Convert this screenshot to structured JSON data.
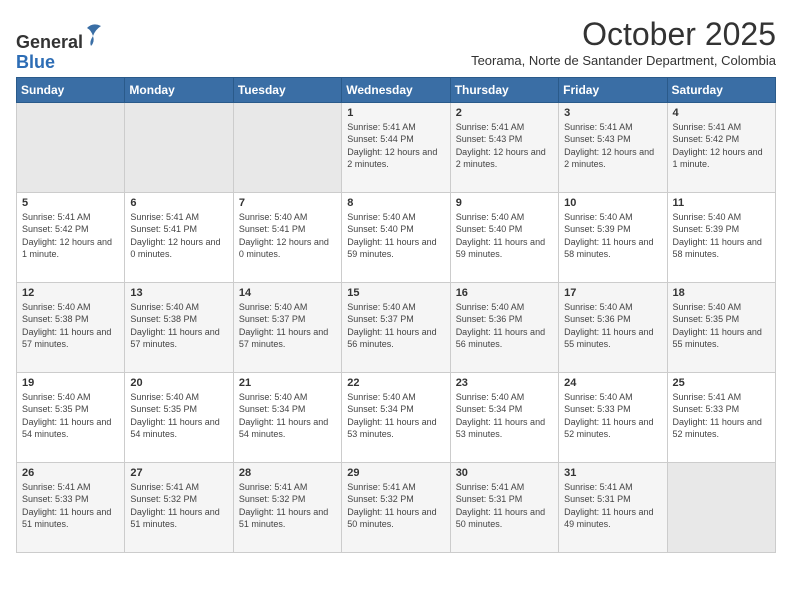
{
  "header": {
    "logo_line1": "General",
    "logo_line2": "Blue",
    "month": "October 2025",
    "subtitle": "Teorama, Norte de Santander Department, Colombia"
  },
  "days_of_week": [
    "Sunday",
    "Monday",
    "Tuesday",
    "Wednesday",
    "Thursday",
    "Friday",
    "Saturday"
  ],
  "weeks": [
    [
      {
        "day": "",
        "info": ""
      },
      {
        "day": "",
        "info": ""
      },
      {
        "day": "",
        "info": ""
      },
      {
        "day": "1",
        "info": "Sunrise: 5:41 AM\nSunset: 5:44 PM\nDaylight: 12 hours and 2 minutes."
      },
      {
        "day": "2",
        "info": "Sunrise: 5:41 AM\nSunset: 5:43 PM\nDaylight: 12 hours and 2 minutes."
      },
      {
        "day": "3",
        "info": "Sunrise: 5:41 AM\nSunset: 5:43 PM\nDaylight: 12 hours and 2 minutes."
      },
      {
        "day": "4",
        "info": "Sunrise: 5:41 AM\nSunset: 5:42 PM\nDaylight: 12 hours and 1 minute."
      }
    ],
    [
      {
        "day": "5",
        "info": "Sunrise: 5:41 AM\nSunset: 5:42 PM\nDaylight: 12 hours and 1 minute."
      },
      {
        "day": "6",
        "info": "Sunrise: 5:41 AM\nSunset: 5:41 PM\nDaylight: 12 hours and 0 minutes."
      },
      {
        "day": "7",
        "info": "Sunrise: 5:40 AM\nSunset: 5:41 PM\nDaylight: 12 hours and 0 minutes."
      },
      {
        "day": "8",
        "info": "Sunrise: 5:40 AM\nSunset: 5:40 PM\nDaylight: 11 hours and 59 minutes."
      },
      {
        "day": "9",
        "info": "Sunrise: 5:40 AM\nSunset: 5:40 PM\nDaylight: 11 hours and 59 minutes."
      },
      {
        "day": "10",
        "info": "Sunrise: 5:40 AM\nSunset: 5:39 PM\nDaylight: 11 hours and 58 minutes."
      },
      {
        "day": "11",
        "info": "Sunrise: 5:40 AM\nSunset: 5:39 PM\nDaylight: 11 hours and 58 minutes."
      }
    ],
    [
      {
        "day": "12",
        "info": "Sunrise: 5:40 AM\nSunset: 5:38 PM\nDaylight: 11 hours and 57 minutes."
      },
      {
        "day": "13",
        "info": "Sunrise: 5:40 AM\nSunset: 5:38 PM\nDaylight: 11 hours and 57 minutes."
      },
      {
        "day": "14",
        "info": "Sunrise: 5:40 AM\nSunset: 5:37 PM\nDaylight: 11 hours and 57 minutes."
      },
      {
        "day": "15",
        "info": "Sunrise: 5:40 AM\nSunset: 5:37 PM\nDaylight: 11 hours and 56 minutes."
      },
      {
        "day": "16",
        "info": "Sunrise: 5:40 AM\nSunset: 5:36 PM\nDaylight: 11 hours and 56 minutes."
      },
      {
        "day": "17",
        "info": "Sunrise: 5:40 AM\nSunset: 5:36 PM\nDaylight: 11 hours and 55 minutes."
      },
      {
        "day": "18",
        "info": "Sunrise: 5:40 AM\nSunset: 5:35 PM\nDaylight: 11 hours and 55 minutes."
      }
    ],
    [
      {
        "day": "19",
        "info": "Sunrise: 5:40 AM\nSunset: 5:35 PM\nDaylight: 11 hours and 54 minutes."
      },
      {
        "day": "20",
        "info": "Sunrise: 5:40 AM\nSunset: 5:35 PM\nDaylight: 11 hours and 54 minutes."
      },
      {
        "day": "21",
        "info": "Sunrise: 5:40 AM\nSunset: 5:34 PM\nDaylight: 11 hours and 54 minutes."
      },
      {
        "day": "22",
        "info": "Sunrise: 5:40 AM\nSunset: 5:34 PM\nDaylight: 11 hours and 53 minutes."
      },
      {
        "day": "23",
        "info": "Sunrise: 5:40 AM\nSunset: 5:34 PM\nDaylight: 11 hours and 53 minutes."
      },
      {
        "day": "24",
        "info": "Sunrise: 5:40 AM\nSunset: 5:33 PM\nDaylight: 11 hours and 52 minutes."
      },
      {
        "day": "25",
        "info": "Sunrise: 5:41 AM\nSunset: 5:33 PM\nDaylight: 11 hours and 52 minutes."
      }
    ],
    [
      {
        "day": "26",
        "info": "Sunrise: 5:41 AM\nSunset: 5:33 PM\nDaylight: 11 hours and 51 minutes."
      },
      {
        "day": "27",
        "info": "Sunrise: 5:41 AM\nSunset: 5:32 PM\nDaylight: 11 hours and 51 minutes."
      },
      {
        "day": "28",
        "info": "Sunrise: 5:41 AM\nSunset: 5:32 PM\nDaylight: 11 hours and 51 minutes."
      },
      {
        "day": "29",
        "info": "Sunrise: 5:41 AM\nSunset: 5:32 PM\nDaylight: 11 hours and 50 minutes."
      },
      {
        "day": "30",
        "info": "Sunrise: 5:41 AM\nSunset: 5:31 PM\nDaylight: 11 hours and 50 minutes."
      },
      {
        "day": "31",
        "info": "Sunrise: 5:41 AM\nSunset: 5:31 PM\nDaylight: 11 hours and 49 minutes."
      },
      {
        "day": "",
        "info": ""
      }
    ]
  ]
}
